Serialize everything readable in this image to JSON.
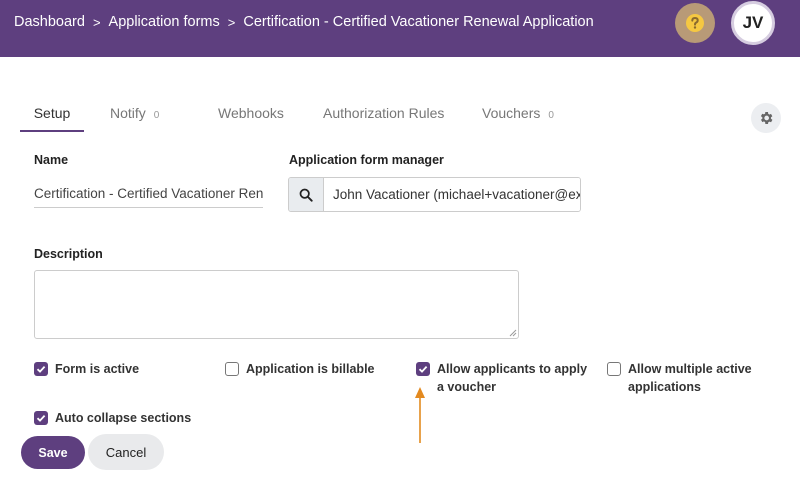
{
  "header": {
    "breadcrumbs": [
      {
        "label": "Dashboard"
      },
      {
        "label": "Application forms"
      },
      {
        "label": "Certification - Certified Vacationer Renewal Application"
      }
    ],
    "help_icon": "question-circle-icon",
    "avatar_initials": "JV"
  },
  "tabs": [
    {
      "label": "Setup",
      "count": ""
    },
    {
      "label": "Notify",
      "count": "0"
    },
    {
      "label": "Webhooks",
      "count": ""
    },
    {
      "label": "Authorization Rules",
      "count": ""
    },
    {
      "label": "Vouchers",
      "count": "0"
    }
  ],
  "form": {
    "name_label": "Name",
    "name_value": "Certification - Certified Vacationer Renewal Application",
    "manager_label": "Application form manager",
    "manager_value": "John Vacationer (michael+vacationer@example.com)",
    "description_label": "Description",
    "description_value": "",
    "checkboxes": [
      {
        "label": "Form is active",
        "checked": true
      },
      {
        "label": "Application is billable",
        "checked": false
      },
      {
        "label": "Allow applicants to apply a voucher",
        "checked": true
      },
      {
        "label": "Allow multiple active applications",
        "checked": false
      },
      {
        "label": "Auto collapse sections",
        "checked": true
      }
    ]
  },
  "actions": {
    "save_label": "Save",
    "cancel_label": "Cancel"
  },
  "colors": {
    "brand": "#5e3f7f",
    "help_bg": "#b89a77",
    "help_icon": "#f5c842",
    "annotation_arrow": "#e38a1f"
  }
}
